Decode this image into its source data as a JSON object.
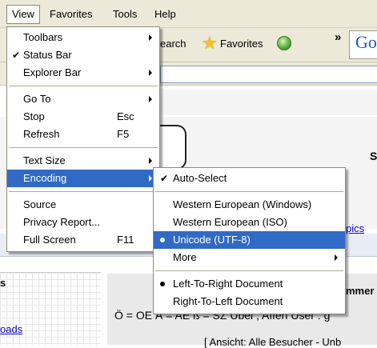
{
  "menubar": {
    "view": "View",
    "favorites": "Favorites",
    "tools": "Tools",
    "help": "Help"
  },
  "toolbar": {
    "search": "earch",
    "favorites": "Favorites",
    "chevrons": "»",
    "google": "Go"
  },
  "page": {
    "s_letter": "S",
    "pics_link": "pics",
    "left_heading": "s",
    "left_link": "oads",
    "right_heading": "mmer",
    "char_line": "Ö = OE Ä = AE ß = SZ Übel , Affen User : g",
    "ansicht": "[ Ansicht: Alle Besucher - Unb"
  },
  "view_menu": {
    "items": [
      {
        "label": "Toolbars",
        "shortcut": ""
      },
      {
        "label": "Status Bar",
        "shortcut": ""
      },
      {
        "label": "Explorer Bar",
        "shortcut": ""
      },
      {
        "label": "Go To",
        "shortcut": ""
      },
      {
        "label": "Stop",
        "shortcut": "Esc"
      },
      {
        "label": "Refresh",
        "shortcut": "F5"
      },
      {
        "label": "Text Size",
        "shortcut": ""
      },
      {
        "label": "Encoding",
        "shortcut": ""
      },
      {
        "label": "Source",
        "shortcut": ""
      },
      {
        "label": "Privacy Report...",
        "shortcut": ""
      },
      {
        "label": "Full Screen",
        "shortcut": "F11"
      }
    ]
  },
  "encoding_menu": {
    "items": [
      {
        "label": "Auto-Select"
      },
      {
        "label": "Western European (Windows)"
      },
      {
        "label": "Western European (ISO)"
      },
      {
        "label": "Unicode (UTF-8)"
      },
      {
        "label": "More"
      },
      {
        "label": "Left-To-Right Document"
      },
      {
        "label": "Right-To-Left Document"
      }
    ]
  },
  "colors": {
    "highlight": "#316ac5",
    "menubar": "#ece9d8",
    "link": "#0000cc"
  }
}
